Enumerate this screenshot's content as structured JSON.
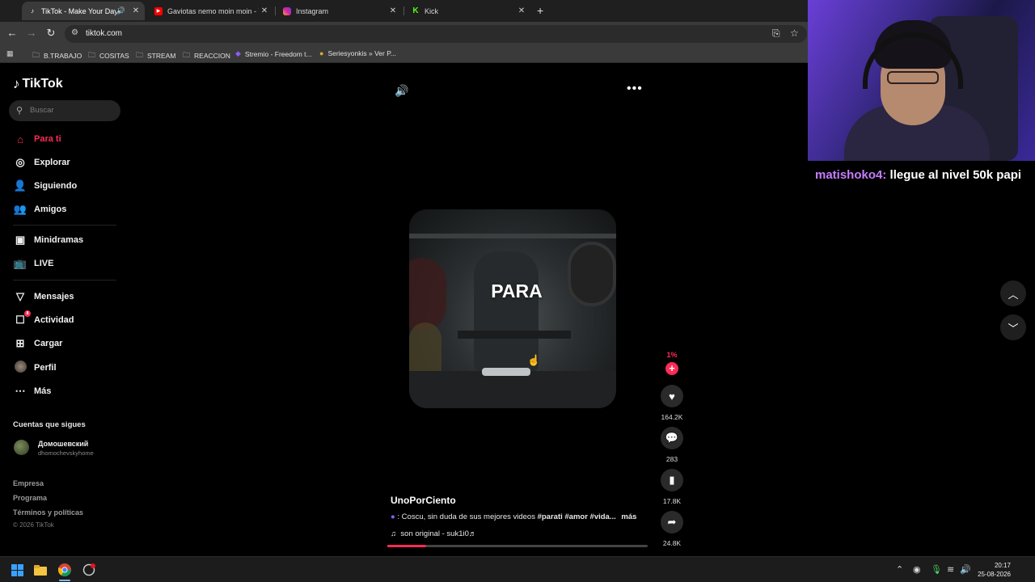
{
  "browser": {
    "tabs": [
      {
        "title": "TikTok - Make Your Day",
        "favicon": "tiktok-icon",
        "active": true,
        "audio": true
      },
      {
        "title": "Gaviotas nemo moin moin - Yo",
        "favicon": "youtube-icon",
        "active": false
      },
      {
        "title": "Instagram",
        "favicon": "instagram-icon",
        "active": false
      },
      {
        "title": "Kick",
        "favicon": "kick-icon",
        "active": false
      }
    ],
    "url": "tiktok.com",
    "bookmarks": [
      {
        "label": "B.TRABAJO",
        "icon": "folder-icon"
      },
      {
        "label": "COSITAS",
        "icon": "folder-icon"
      },
      {
        "label": "STREAM",
        "icon": "folder-icon"
      },
      {
        "label": "REACCION",
        "icon": "folder-icon"
      },
      {
        "label": "Stremio - Freedom t...",
        "icon": "stremio-icon"
      },
      {
        "label": "Seriesyonkis » Ver P...",
        "icon": "seriesyonkis-icon"
      }
    ]
  },
  "tiktok": {
    "logo": "TikTok",
    "search_placeholder": "Buscar",
    "nav": [
      {
        "label": "Para ti",
        "icon": "home-icon",
        "active": true
      },
      {
        "label": "Explorar",
        "icon": "compass-icon"
      },
      {
        "label": "Siguiendo",
        "icon": "following-icon"
      },
      {
        "label": "Amigos",
        "icon": "friends-icon"
      },
      {
        "label": "Minidramas",
        "icon": "minidramas-icon"
      },
      {
        "label": "LIVE",
        "icon": "live-icon"
      },
      {
        "label": "Mensajes",
        "icon": "messages-icon"
      },
      {
        "label": "Actividad",
        "icon": "activity-icon",
        "badge": "8"
      },
      {
        "label": "Cargar",
        "icon": "upload-icon"
      },
      {
        "label": "Perfil",
        "icon": "profile-avatar"
      },
      {
        "label": "Más",
        "icon": "more-icon"
      }
    ],
    "following_title": "Cuentas que sigues",
    "following": [
      {
        "name": "Домошевский",
        "username": "dhomochevskyhome"
      }
    ],
    "footer": [
      "Empresa",
      "Programa",
      "Términos y políticas"
    ],
    "copyright": "© 2026 TikTok"
  },
  "video": {
    "caption_overlay": "PARA",
    "author": "UnoPorCiento",
    "description": ": Coscu, sin duda de sus mejores videos",
    "hashtags": "#parati #amor #vida...",
    "more_label": "más",
    "music": "son original - suk1i0♬",
    "creator_badge": "1%",
    "likes": "164.2K",
    "comments": "283",
    "saves": "17.8K",
    "shares": "24.8K",
    "progress": 0.15
  },
  "stream": {
    "chat_user": "matishoko4:",
    "chat_message": "llegue al nivel 50k papi"
  },
  "taskbar": {
    "time": "20:17",
    "date": "25-08-2026"
  },
  "colors": {
    "accent": "#fe2c55",
    "chat_user": "#c77dff"
  }
}
